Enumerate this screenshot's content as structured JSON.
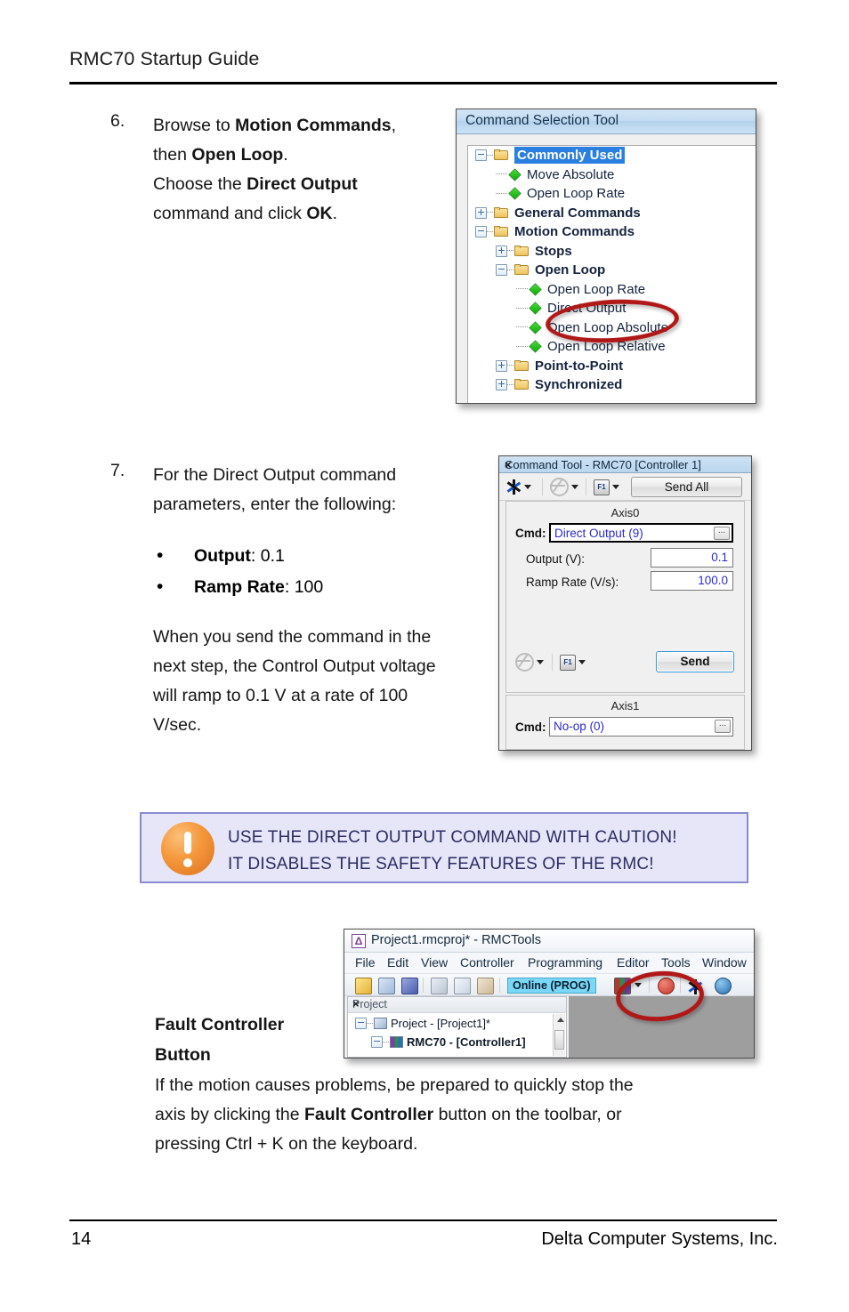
{
  "document": {
    "header_title": "RMC70 Startup Guide",
    "footer_page": "14",
    "footer_company": "Delta Computer Systems, Inc."
  },
  "steps": [
    {
      "number": "6.",
      "lines": [
        {
          "parts": [
            {
              "t": "Browse to ",
              "b": false
            },
            {
              "t": "Motion Commands",
              "b": true
            },
            {
              "t": ",",
              "b": false
            }
          ]
        },
        {
          "parts": [
            {
              "t": "then ",
              "b": false
            },
            {
              "t": "Open Loop",
              "b": true
            },
            {
              "t": ".",
              "b": false
            }
          ]
        },
        {
          "parts": [
            {
              "t": "Choose the ",
              "b": false
            },
            {
              "t": "Direct Output",
              "b": true
            }
          ]
        },
        {
          "parts": [
            {
              "t": "command and click ",
              "b": false
            },
            {
              "t": "OK",
              "b": true
            },
            {
              "t": ".",
              "b": false
            }
          ]
        }
      ]
    },
    {
      "number": "7.",
      "lines": [
        {
          "parts": [
            {
              "t": "For the Direct Output command",
              "b": false
            }
          ]
        },
        {
          "parts": [
            {
              "t": "parameters, enter the following:",
              "b": false
            }
          ]
        }
      ],
      "bullets": [
        {
          "parts": [
            {
              "t": "Output",
              "b": true
            },
            {
              "t": ": 0.1",
              "b": false
            }
          ]
        },
        {
          "parts": [
            {
              "t": "Ramp Rate",
              "b": true
            },
            {
              "t": ": 100",
              "b": false
            }
          ]
        }
      ],
      "after_lines": [
        {
          "parts": [
            {
              "t": "When you send the command in the",
              "b": false
            }
          ]
        },
        {
          "parts": [
            {
              "t": "next step, the Control Output voltage",
              "b": false
            }
          ]
        },
        {
          "parts": [
            {
              "t": "will ramp to 0.1 V at a rate of 100",
              "b": false
            }
          ]
        },
        {
          "parts": [
            {
              "t": "V/sec.",
              "b": false
            }
          ]
        }
      ]
    }
  ],
  "warning": {
    "line1": "USE THE DIRECT OUTPUT COMMAND WITH CAUTION!",
    "line2": "IT DISABLES THE SAFETY FEATURES OF THE RMC!",
    "icon": "exclamation-circle-icon",
    "border_color": "#8a8ad0",
    "background_color": "#e6e6f8",
    "icon_color": "#f5993d"
  },
  "fault_section": {
    "heading_line1": "Fault Controller",
    "heading_line2": "Button",
    "body_lines": [
      {
        "parts": [
          {
            "t": "If the motion causes problems, be prepared to quickly stop the",
            "b": false
          }
        ]
      },
      {
        "parts": [
          {
            "t": "axis by clicking the ",
            "b": false
          },
          {
            "t": "Fault Controller",
            "b": true
          },
          {
            "t": " button on the toolbar, or",
            "b": false
          }
        ]
      },
      {
        "parts": [
          {
            "t": "pressing Ctrl + K on the keyboard.",
            "b": false
          }
        ]
      }
    ]
  },
  "command_selection_tool": {
    "title": "Command Selection Tool",
    "highlight_color": "#2a7fe0",
    "tree": [
      {
        "label": "Commonly Used",
        "depth": 0,
        "type": "folder",
        "expander": "minus",
        "bold": true,
        "selected": true
      },
      {
        "label": "Move Absolute",
        "depth": 1,
        "type": "command",
        "expander": "none",
        "bold": false,
        "selected": false
      },
      {
        "label": "Open Loop Rate",
        "depth": 1,
        "type": "command",
        "expander": "none",
        "bold": false,
        "selected": false
      },
      {
        "label": "General Commands",
        "depth": 0,
        "type": "folder",
        "expander": "plus",
        "bold": true,
        "selected": false
      },
      {
        "label": "Motion Commands",
        "depth": 0,
        "type": "folder",
        "expander": "minus",
        "bold": true,
        "selected": false
      },
      {
        "label": "Stops",
        "depth": 1,
        "type": "folder",
        "expander": "plus",
        "bold": true,
        "selected": false
      },
      {
        "label": "Open Loop",
        "depth": 1,
        "type": "folder",
        "expander": "minus",
        "bold": true,
        "selected": false
      },
      {
        "label": "Open Loop Rate",
        "depth": 2,
        "type": "command",
        "expander": "none",
        "bold": false,
        "selected": false
      },
      {
        "label": "Direct Output",
        "depth": 2,
        "type": "command",
        "expander": "none",
        "bold": false,
        "selected": false
      },
      {
        "label": "Open Loop Absolute",
        "depth": 2,
        "type": "command",
        "expander": "none",
        "bold": false,
        "selected": false
      },
      {
        "label": "Open Loop Relative",
        "depth": 2,
        "type": "command",
        "expander": "none",
        "bold": false,
        "selected": false
      },
      {
        "label": "Point-to-Point",
        "depth": 1,
        "type": "folder",
        "expander": "plus",
        "bold": true,
        "selected": false
      },
      {
        "label": "Synchronized",
        "depth": 1,
        "type": "folder",
        "expander": "plus",
        "bold": true,
        "selected": false
      }
    ],
    "annotation": "red-ellipse-highlight-direct-output"
  },
  "command_tool": {
    "title": "Command Tool - RMC70 [Controller 1]",
    "close_label": "×",
    "toolbar": {
      "fault_icon": "fault-controller-icon",
      "clock_icon": "clock-icon",
      "fkey_icon": "f1-key-icon",
      "fkey_text": "F1",
      "send_all_label": "Send All"
    },
    "axis0": {
      "title": "Axis0",
      "cmd_label": "Cmd:",
      "cmd_value": "Direct Output (9)",
      "browse_label": "...",
      "fields": [
        {
          "label": "Output (V):",
          "value": "0.1"
        },
        {
          "label": "Ramp Rate (V/s):",
          "value": "100.0"
        }
      ],
      "send_label": "Send"
    },
    "axis1": {
      "title": "Axis1",
      "cmd_label": "Cmd:",
      "cmd_value": "No-op (0)",
      "browse_label": "..."
    }
  },
  "rmctools": {
    "title": "Project1.rmcproj* - RMCTools",
    "app_icon": "rmctools-logo-icon",
    "app_icon_glyph": "Δ",
    "menus": [
      "File",
      "Edit",
      "View",
      "Controller",
      "Programming",
      "Editor",
      "Tools",
      "Window"
    ],
    "toolbar": {
      "icons": [
        "new-project-icon",
        "open-project-icon",
        "save-icon",
        "cut-icon",
        "copy-icon",
        "paste-icon"
      ],
      "status_chip": "Online (PROG)",
      "mode_icon": "controller-mode-icon",
      "fault_controller_icon": "fault-controller-stop-icon",
      "fault_icon": "fault-icon",
      "help_icon": "help-icon"
    },
    "project_pane": {
      "title": "Project",
      "close_label": "×",
      "nodes": [
        {
          "label": "Project - [Project1]*",
          "depth": 0,
          "icon": "project-icon",
          "expander": "minus"
        },
        {
          "label": "RMC70 - [Controller1]",
          "depth": 1,
          "icon": "controller-icon",
          "expander": "minus"
        }
      ]
    },
    "annotation": "red-ellipse-highlight-fault-controller-button"
  }
}
